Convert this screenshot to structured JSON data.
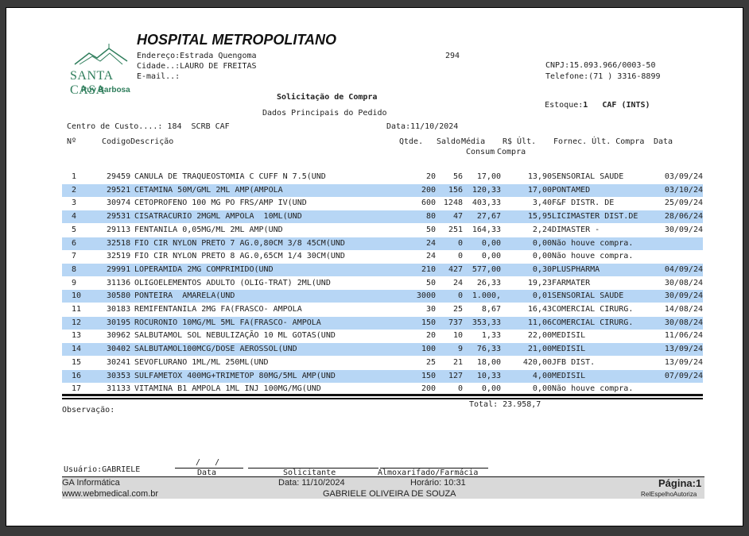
{
  "header": {
    "hospital_name": "HOSPITAL METROPOLITANO",
    "address": "Endereço:Estrada Quengoma",
    "city": "Cidade..:LAURO DE FREITAS",
    "email": "E-mail..:",
    "number": "294",
    "cnpj": "CNPJ:15.093.966/0003-50",
    "phone": "Telefone:(71 ) 3316-8899",
    "logo_name": "SANTA CASA",
    "logo_sub": "Ruy Barbosa"
  },
  "doc": {
    "title": "Solicitação de Compra",
    "stock_label": "Estoque:",
    "stock_value": "1",
    "stock_name": "CAF (INTS)",
    "section": "Dados Principais do Pedido",
    "cost_center": "Centro de Custo....: 184  SCRB CAF",
    "date": "Data:11/10/2024"
  },
  "columns": {
    "num": "Nº",
    "code_desc": "CodigoDescrição",
    "qty": "Qtde.",
    "balance": "Saldo",
    "avg": "Média",
    "avg2": "Consum",
    "price": "R$ Últ.",
    "price2": "Compra",
    "supplier": "Fornec. Últ. Compra",
    "date": "Data"
  },
  "rows": [
    {
      "n": "1",
      "code": "29459",
      "desc": "CANULA DE TRAQUEOSTOMIA C CUFF N 7.5(UND",
      "qty": "20",
      "bal": "56",
      "avg": "17,00",
      "price": "13,90",
      "sup": "SENSORIAL SAUDE",
      "date": "03/09/24"
    },
    {
      "n": "2",
      "code": "29521",
      "desc": "CETAMINA 50M/GML 2ML AMP(AMPOLA",
      "qty": "200",
      "bal": "156",
      "avg": "120,33",
      "price": "17,00",
      "sup": "PONTAMED",
      "date": "03/10/24"
    },
    {
      "n": "3",
      "code": "30974",
      "desc": "CETOPROFENO 100 MG PO FRS/AMP IV(UND",
      "qty": "600",
      "bal": "1248",
      "avg": "403,33",
      "price": "3,40",
      "sup": "F&F DISTR. DE",
      "date": "25/09/24"
    },
    {
      "n": "4",
      "code": "29531",
      "desc": "CISATRACURIO 2MGML AMPOLA  10ML(UND",
      "qty": "80",
      "bal": "47",
      "avg": "27,67",
      "price": "15,95",
      "sup": "LICIMASTER DIST.DE",
      "date": "28/06/24"
    },
    {
      "n": "5",
      "code": "29113",
      "desc": "FENTANILA 0,05MG/ML 2ML AMP(UND",
      "qty": "50",
      "bal": "251",
      "avg": "164,33",
      "price": "2,24",
      "sup": "DIMASTER -",
      "date": "30/09/24"
    },
    {
      "n": "6",
      "code": "32518",
      "desc": "FIO CIR NYLON PRETO 7 AG.0,80CM 3/8 45CM(UND",
      "qty": "24",
      "bal": "0",
      "avg": "0,00",
      "price": "0,00",
      "sup": "Não houve compra.",
      "date": ""
    },
    {
      "n": "7",
      "code": "32519",
      "desc": "FIO CIR NYLON PRETO 8 AG.0,65CM 1/4 30CM(UND",
      "qty": "24",
      "bal": "0",
      "avg": "0,00",
      "price": "0,00",
      "sup": "Não houve compra.",
      "date": ""
    },
    {
      "n": "8",
      "code": "29991",
      "desc": "LOPERAMIDA 2MG COMPRIMIDO(UND",
      "qty": "210",
      "bal": "427",
      "avg": "577,00",
      "price": "0,30",
      "sup": "PLUSPHARMA",
      "date": "04/09/24"
    },
    {
      "n": "9",
      "code": "31136",
      "desc": "OLIGOELEMENTOS ADULTO (OLIG-TRAT) 2ML(UND",
      "qty": "50",
      "bal": "24",
      "avg": "26,33",
      "price": "19,23",
      "sup": "FARMATER",
      "date": "30/08/24"
    },
    {
      "n": "10",
      "code": "30580",
      "desc": "PONTEIRA  AMARELA(UND",
      "qty": "3000",
      "bal": "0",
      "avg": "1.000,",
      "price": "0,01",
      "sup": "SENSORIAL SAUDE",
      "date": "30/09/24"
    },
    {
      "n": "11",
      "code": "30183",
      "desc": "REMIFENTANILA 2MG FA(FRASCO- AMPOLA",
      "qty": "30",
      "bal": "25",
      "avg": "8,67",
      "price": "16,43",
      "sup": "COMERCIAL CIRURG.",
      "date": "14/08/24"
    },
    {
      "n": "12",
      "code": "30195",
      "desc": "ROCURONIO 10MG/ML 5ML FA(FRASCO- AMPOLA",
      "qty": "150",
      "bal": "737",
      "avg": "353,33",
      "price": "11,06",
      "sup": "COMERCIAL CIRURG.",
      "date": "30/08/24"
    },
    {
      "n": "13",
      "code": "30962",
      "desc": "SALBUTAMOL SOL NEBULIZAÇÃO 10 ML GOTAS(UND",
      "qty": "20",
      "bal": "10",
      "avg": "1,33",
      "price": "22,00",
      "sup": "MEDISIL",
      "date": "11/06/24"
    },
    {
      "n": "14",
      "code": "30402",
      "desc": "SALBUTAMOL100MCG/DOSE AEROSSOL(UND",
      "qty": "100",
      "bal": "9",
      "avg": "76,33",
      "price": "21,00",
      "sup": "MEDISIL",
      "date": "13/09/24"
    },
    {
      "n": "15",
      "code": "30241",
      "desc": "SEVOFLURANO 1ML/ML 250ML(UND",
      "qty": "25",
      "bal": "21",
      "avg": "18,00",
      "price": "420,00",
      "sup": "JFB DIST.",
      "date": "13/09/24"
    },
    {
      "n": "16",
      "code": "30353",
      "desc": "SULFAMETOX 400MG+TRIMETOP 80MG/5ML AMP(UND",
      "qty": "150",
      "bal": "127",
      "avg": "10,33",
      "price": "4,00",
      "sup": "MEDISIL",
      "date": "07/09/24"
    },
    {
      "n": "17",
      "code": "31133",
      "desc": "VITAMINA B1 AMPOLA 1ML INJ 100MG/MG(UND",
      "qty": "200",
      "bal": "0",
      "avg": "0,00",
      "price": "0,00",
      "sup": "Não houve compra.",
      "date": ""
    }
  ],
  "total": "Total: 23.958,7",
  "observation": "Observação:",
  "signature": {
    "user": "Usuário:GABRIELE",
    "date_slashes": "/   /",
    "date_label": "Data",
    "requester_label": "Solicitante",
    "warehouse_label": "Almoxarifado/Farmácia"
  },
  "footer": {
    "company": "GA Informática",
    "site": "www.webmedical.com.br",
    "date": "Data: 11/10/2024",
    "time": "Horário: 10:31",
    "name": "GABRIELE OLIVEIRA DE SOUZA",
    "page": "Página:1",
    "report": "RelEspelhoAutoriza"
  },
  "colors": {
    "row_alt": "#b7d6f5",
    "logo": "#2e7d5b",
    "footer_bar": "#d9d9d9"
  }
}
